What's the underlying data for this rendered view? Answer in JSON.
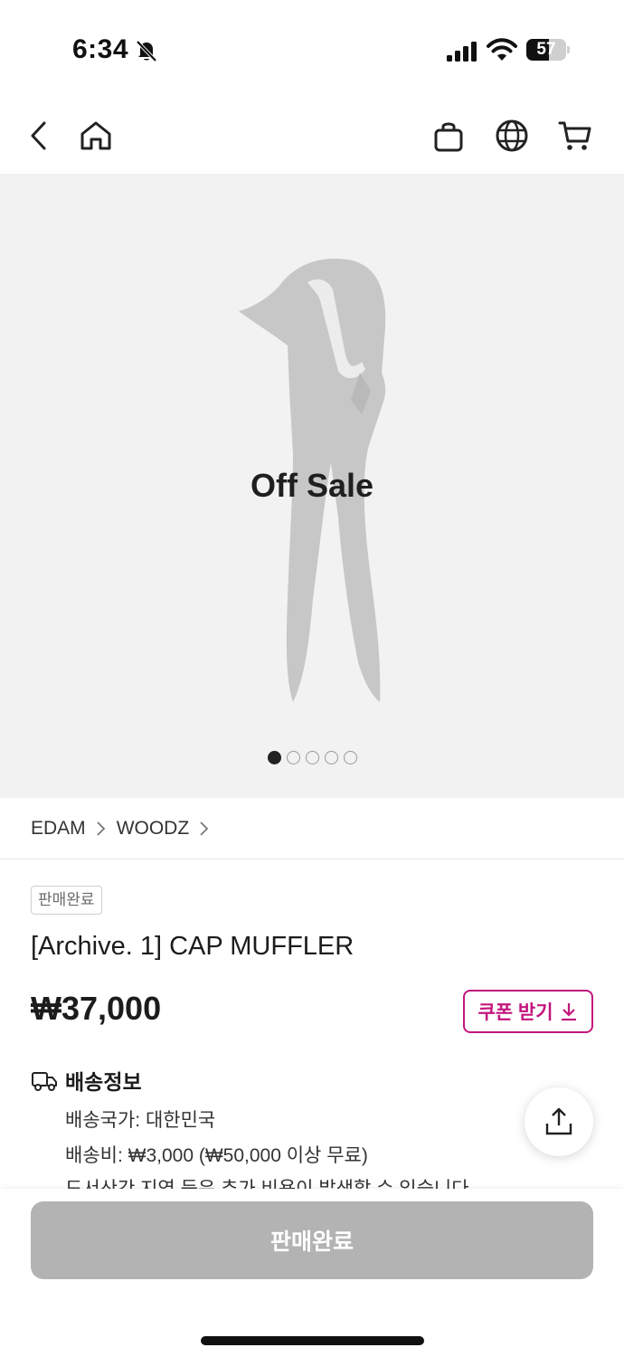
{
  "status_bar": {
    "time": "6:34",
    "battery_level": "57",
    "battery_fraction": 0.57
  },
  "nav": {
    "icons": [
      "back-icon",
      "home-icon",
      "shopping-bag-icon",
      "globe-icon",
      "cart-icon"
    ]
  },
  "gallery": {
    "overlay_text": "Off Sale",
    "image_count": 5,
    "active_index": 0
  },
  "breadcrumb": [
    "EDAM",
    "WOODZ"
  ],
  "product": {
    "status_badge": "판매완료",
    "title": "[Archive. 1] CAP MUFFLER",
    "price": "₩37,000",
    "coupon_label": "쿠폰 받기"
  },
  "shipping": {
    "heading": "배송정보",
    "lines": [
      "배송국가: 대한민국",
      "배송비: ₩3,000 (₩50,000 이상 무료)",
      "도서산간 지역 등은 추가 비용이 발생할 수 있습니다"
    ]
  },
  "bottom": {
    "button_label": "판매완료"
  },
  "colors": {
    "accent": "#c2167d",
    "disabled_button": "#b3b3b3",
    "gallery_bg": "#f2f2f2"
  }
}
